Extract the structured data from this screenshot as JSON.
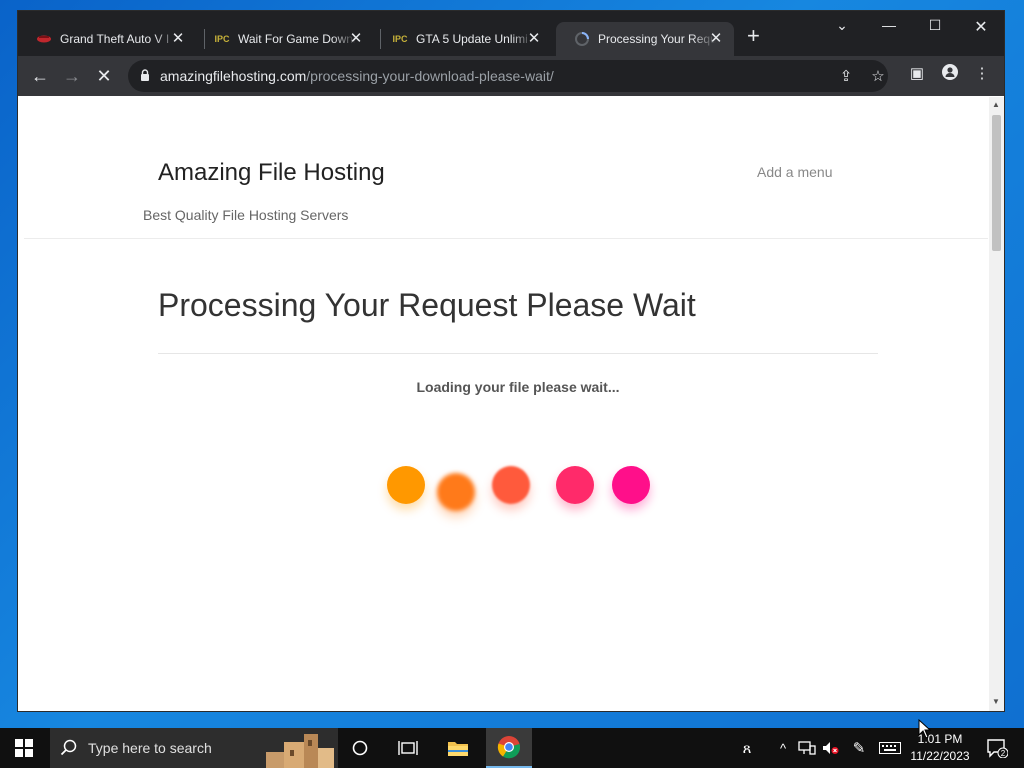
{
  "browser": {
    "tabs": [
      {
        "title": "Grand Theft Auto V I",
        "favicon": "gta-icon"
      },
      {
        "title": "Wait For Game Downl",
        "favicon": "ipc-icon"
      },
      {
        "title": "GTA 5 Update Unlimi",
        "favicon": "ipc-icon"
      },
      {
        "title": "Processing Your Requ",
        "favicon": "loading-spinner-icon",
        "active": true
      }
    ],
    "favicon_text": "IPC",
    "address": {
      "host": "amazingfilehosting.com",
      "path": "/processing-your-download-please-wait/"
    }
  },
  "page": {
    "site_title": "Amazing File Hosting",
    "tagline": "Best Quality File Hosting Servers",
    "menu_link": "Add a menu",
    "heading": "Processing Your Request Please Wait",
    "loading_text": "Loading your file please wait...",
    "dot_colors": [
      "#ff9800",
      "#ff7a1a",
      "#ff5a3c",
      "#ff2a6a",
      "#ff0f8a"
    ]
  },
  "taskbar": {
    "search_placeholder": "Type here to search",
    "time": "1:01 PM",
    "date": "11/22/2023",
    "notification_count": "2"
  }
}
